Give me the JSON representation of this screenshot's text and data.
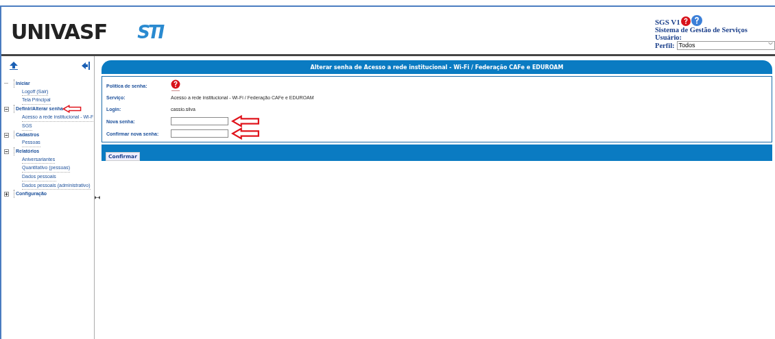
{
  "header": {
    "logo_text": "UNIVASF",
    "sti_text": "STI",
    "app_version": "SGS V1",
    "app_name": "Sistema de Gestão de Serviços",
    "user_label": "Usuário:",
    "profile_label": "Perfil:",
    "profile_value": "Todos"
  },
  "sidebar": {
    "items": [
      {
        "label": "Iniciar",
        "expanded": true,
        "marked": false,
        "children": [
          {
            "label": "Logoff (Sair)",
            "marked": false
          },
          {
            "label": "Tela Principal",
            "marked": false
          }
        ]
      },
      {
        "label": "Definir/Alterar senha",
        "expanded": true,
        "marked": true,
        "children": [
          {
            "label": "Acesso a rede institucional - Wi-F",
            "marked": false
          },
          {
            "label": "SGS",
            "marked": false
          }
        ]
      },
      {
        "label": "Cadastros",
        "expanded": true,
        "marked": false,
        "children": [
          {
            "label": "Pessoas",
            "marked": false
          }
        ]
      },
      {
        "label": "Relatórios",
        "expanded": true,
        "marked": false,
        "children": [
          {
            "label": "Aniversariantes",
            "marked": false
          },
          {
            "label": "Quantitativo (pessoas)",
            "marked": false
          },
          {
            "label": "Dados pessoais",
            "marked": false
          },
          {
            "label": "Dados pessoais (administrativo)",
            "marked": false
          }
        ]
      },
      {
        "label": "Configuração",
        "expanded": false,
        "marked": false
      }
    ]
  },
  "form": {
    "title": "Alterar senha de Acesso a rede institucional - Wi-Fi / Federação CAFe e EDUROAM",
    "rows": [
      {
        "kind": "help",
        "label": "Política de senha:"
      },
      {
        "kind": "text",
        "label": "Serviço:",
        "value": "Acesso a rede institucional - Wi-Fi / Federação CAFe e EDUROAM"
      },
      {
        "kind": "text",
        "label": "Login:",
        "value": "cassio.silva"
      },
      {
        "kind": "input",
        "label": "Nova senha:",
        "marked": true
      },
      {
        "kind": "input",
        "label": "Confirmar nova senha:",
        "marked": true
      }
    ],
    "submit": "Confirmar"
  }
}
